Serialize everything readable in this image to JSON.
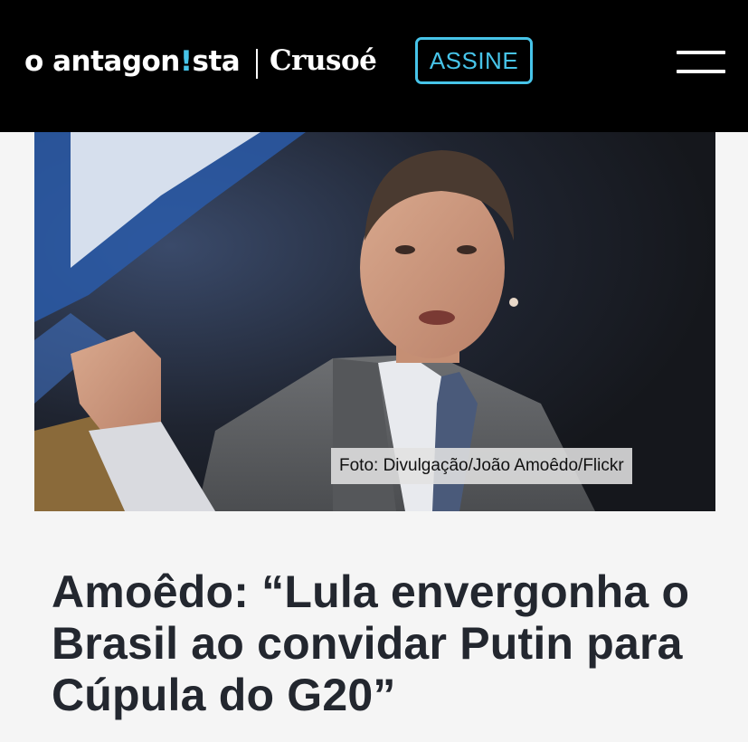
{
  "header": {
    "logo_prefix": "o antagon",
    "logo_mark": "!",
    "logo_suffix": "sta",
    "brand_secondary": "Crusoé",
    "subscribe_label": "ASSINE",
    "menu_icon": "hamburger-menu-icon",
    "accent_color": "#47c4e9",
    "background_color": "#000000"
  },
  "article": {
    "photo_credit": "Foto: Divulgação/João Amoêdo/Flickr",
    "headline": "Amoêdo: “Lula envergonha o Brasil ao convidar Putin para Cúpula do G20”",
    "headline_color": "#23272f"
  }
}
